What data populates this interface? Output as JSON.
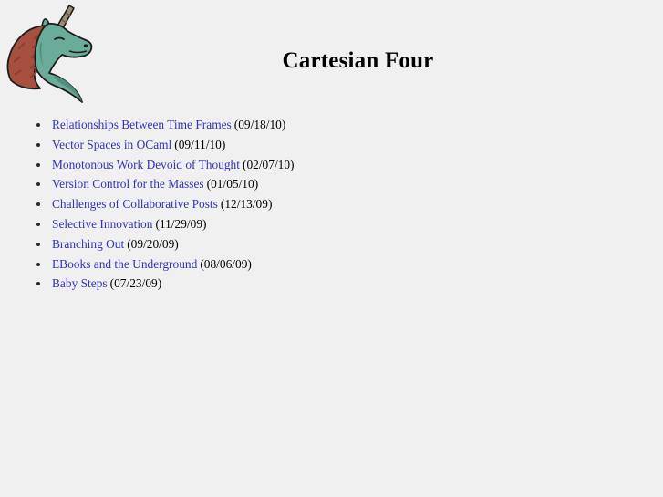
{
  "site": {
    "title": "Cartesian Four",
    "background_color": "#f0f0f0",
    "link_color": "#3333bb",
    "text_color": "#000000"
  },
  "logo": {
    "icon_name": "unicorn-head-logo",
    "body_color": "#6aab99",
    "body_shade_color": "#4f8f7d",
    "mane_color": "#a85040",
    "mane_shade_color": "#8d3f31",
    "horn_color": "#9c8d76",
    "horn_shade_color": "#6f6353",
    "outline_color": "#1c1c1c"
  },
  "posts": [
    {
      "title": "Relationships Between Time Frames",
      "date": "(09/18/10)"
    },
    {
      "title": "Vector Spaces in OCaml",
      "date": "(09/11/10)"
    },
    {
      "title": "Monotonous Work Devoid of Thought",
      "date": "(02/07/10)"
    },
    {
      "title": "Version Control for the Masses",
      "date": "(01/05/10)"
    },
    {
      "title": "Challenges of Collaborative Posts",
      "date": "(12/13/09)"
    },
    {
      "title": "Selective Innovation",
      "date": "(11/29/09)"
    },
    {
      "title": "Branching Out",
      "date": "(09/20/09)"
    },
    {
      "title": "EBooks and the Underground",
      "date": "(08/06/09)"
    },
    {
      "title": "Baby Steps",
      "date": "(07/23/09)"
    }
  ]
}
